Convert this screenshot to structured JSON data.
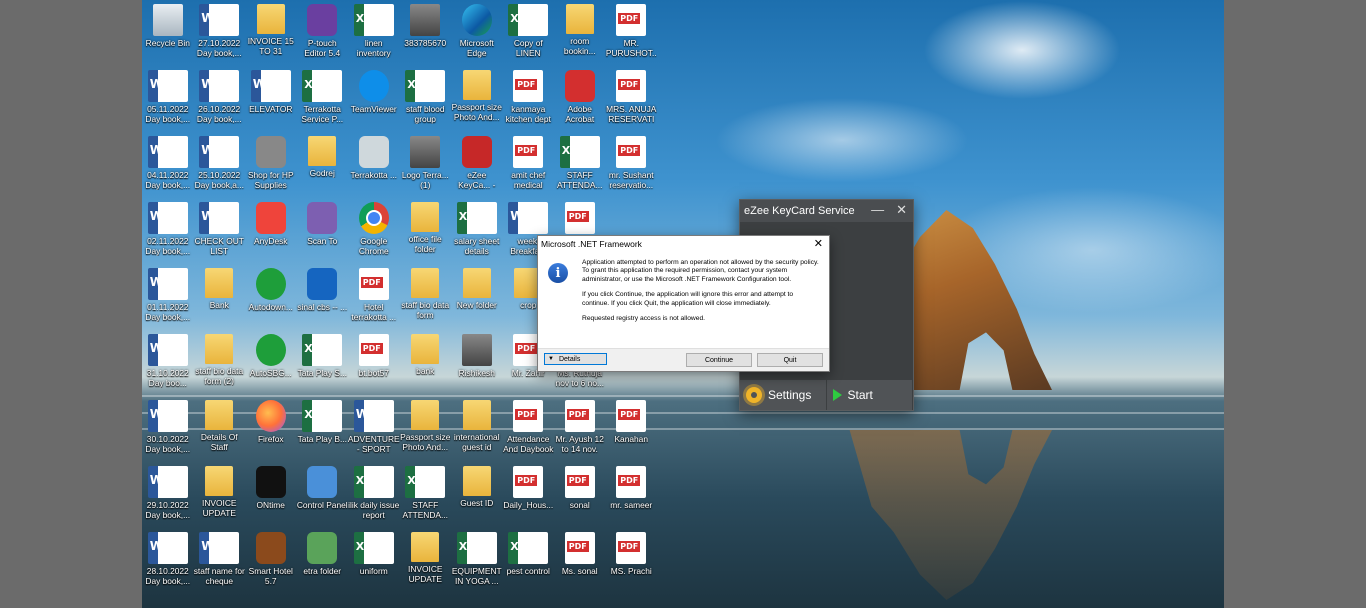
{
  "desktop": {
    "icons": [
      {
        "label": "Recycle Bin",
        "type": "recycle",
        "icon": "recycle-bin-icon"
      },
      {
        "label": "27.10.2022 Day book,...",
        "type": "word",
        "icon": "word-doc-icon"
      },
      {
        "label": "INVOICE 15 TO 31",
        "type": "folder",
        "icon": "folder-icon"
      },
      {
        "label": "P-touch Editor 5.4",
        "type": "app",
        "icon": "ptouch-icon",
        "color": "#6a3fa0"
      },
      {
        "label": "linen inventory",
        "type": "excel",
        "icon": "excel-doc-icon"
      },
      {
        "label": "383785670",
        "type": "photo",
        "icon": "image-file-icon"
      },
      {
        "label": "Microsoft Edge",
        "type": "edge",
        "icon": "edge-icon"
      },
      {
        "label": "Copy of LINEN INVE...",
        "type": "excel",
        "icon": "excel-doc-icon"
      },
      {
        "label": "room bookin...",
        "type": "folder",
        "icon": "folder-icon"
      },
      {
        "label": "MR. PURUSHOT...",
        "type": "pdf",
        "icon": "pdf-icon"
      },
      {
        "label": "05.11.2022 Day book,...",
        "type": "word",
        "icon": "word-doc-icon"
      },
      {
        "label": "26.10.2022 Day book,...",
        "type": "word",
        "icon": "word-doc-icon"
      },
      {
        "label": "ELEVATOR",
        "type": "word",
        "icon": "word-doc-icon"
      },
      {
        "label": "Terrakotta Service P...",
        "type": "excel",
        "icon": "excel-doc-icon"
      },
      {
        "label": "TeamViewer",
        "type": "tv",
        "icon": "teamviewer-icon"
      },
      {
        "label": "staff blood group",
        "type": "excel",
        "icon": "excel-doc-icon"
      },
      {
        "label": "Passport size Photo And...",
        "type": "folder",
        "icon": "folder-icon"
      },
      {
        "label": "kanmaya kitchen dept",
        "type": "pdf",
        "icon": "document-icon"
      },
      {
        "label": "Adobe Acrobat",
        "type": "app",
        "icon": "acrobat-icon",
        "color": "#d32f2f"
      },
      {
        "label": "MRS. ANUJA RESERVATIO...",
        "type": "pdf",
        "icon": "pdf-icon"
      },
      {
        "label": "04.11.2022 Day book,...",
        "type": "word",
        "icon": "word-doc-icon"
      },
      {
        "label": "25.10.2022 Day book,a...",
        "type": "word",
        "icon": "word-doc-icon"
      },
      {
        "label": "Shop for HP Supplies",
        "type": "app",
        "icon": "printer-icon",
        "color": "#888888"
      },
      {
        "label": "Godrej",
        "type": "folder",
        "icon": "folder-icon"
      },
      {
        "label": "Terrakotta ...",
        "type": "app",
        "icon": "phone-app-icon",
        "color": "#cfd8dc"
      },
      {
        "label": "Logo Terra... (1)",
        "type": "photo",
        "icon": "image-file-icon"
      },
      {
        "label": "eZee KeyCa... - Shortcut",
        "type": "app",
        "icon": "ezee-key-icon",
        "color": "#c62828"
      },
      {
        "label": "amit chef medical",
        "type": "pdf",
        "icon": "document-icon"
      },
      {
        "label": "STAFF ATTENDA...",
        "type": "excel",
        "icon": "excel-doc-icon"
      },
      {
        "label": "mr. Sushant reservatio...",
        "type": "pdf",
        "icon": "pdf-icon"
      },
      {
        "label": "02.11.2022 Day book,...",
        "type": "word",
        "icon": "word-doc-icon"
      },
      {
        "label": "CHECK OUT LIST",
        "type": "word",
        "icon": "word-doc-icon"
      },
      {
        "label": "AnyDesk",
        "type": "app",
        "icon": "anydesk-icon",
        "color": "#ef443b"
      },
      {
        "label": "Scan To",
        "type": "app",
        "icon": "scan-icon",
        "color": "#7d5fb1"
      },
      {
        "label": "Google Chrome",
        "type": "chrome",
        "icon": "chrome-icon"
      },
      {
        "label": "office file folder",
        "type": "folder",
        "icon": "folder-icon"
      },
      {
        "label": "salary sheet details",
        "type": "excel",
        "icon": "excel-doc-icon"
      },
      {
        "label": "weekl Breakfa...",
        "type": "word",
        "icon": "word-doc-icon"
      },
      {
        "label": "",
        "type": "pdf",
        "icon": "document-icon"
      },
      {
        "label": "",
        "type": "none",
        "icon": ""
      },
      {
        "label": "01.11.2022 Day book,...",
        "type": "word",
        "icon": "word-doc-icon"
      },
      {
        "label": "Bank",
        "type": "folder",
        "icon": "folder-icon"
      },
      {
        "label": "Autodown...",
        "type": "green-round",
        "icon": "autodown-icon"
      },
      {
        "label": "sinal cbs -- ...",
        "type": "app",
        "icon": "sinal-icon",
        "color": "#1565c0"
      },
      {
        "label": "Hotel terrakotta ...",
        "type": "pdf",
        "icon": "pdf-icon"
      },
      {
        "label": "staff bio data form",
        "type": "folder",
        "icon": "folder-icon"
      },
      {
        "label": "New folder",
        "type": "folder",
        "icon": "folder-icon"
      },
      {
        "label": "crop",
        "type": "folder",
        "icon": "folder-icon"
      },
      {
        "label": "",
        "type": "none",
        "icon": ""
      },
      {
        "label": "",
        "type": "none",
        "icon": ""
      },
      {
        "label": "31.10.2022 Day boo...",
        "type": "word",
        "icon": "word-doc-icon"
      },
      {
        "label": "staff bio data form (2)",
        "type": "folder",
        "icon": "folder-icon"
      },
      {
        "label": "AutoSBG...",
        "type": "green-round",
        "icon": "autosbg-icon"
      },
      {
        "label": "Tata Play S...",
        "type": "excel",
        "icon": "excel-doc-icon"
      },
      {
        "label": "bt.bot57",
        "type": "pdf",
        "icon": "document-icon"
      },
      {
        "label": "bank",
        "type": "folder",
        "icon": "folder-icon"
      },
      {
        "label": "Rishikesh",
        "type": "photo",
        "icon": "person-photo-icon"
      },
      {
        "label": "Mr. Zahir",
        "type": "pdf",
        "icon": "pdf-icon"
      },
      {
        "label": "Ms. Ruthuja nov to 6 no...",
        "type": "pdf",
        "icon": "pdf-icon"
      },
      {
        "label": "",
        "type": "none",
        "icon": ""
      },
      {
        "label": "30.10.2022 Day book,...",
        "type": "word",
        "icon": "word-doc-icon"
      },
      {
        "label": "Details Of Staff",
        "type": "folder",
        "icon": "folder-icon"
      },
      {
        "label": "Firefox",
        "type": "firefox",
        "icon": "firefox-icon"
      },
      {
        "label": "Tata Play B...",
        "type": "excel",
        "icon": "excel-doc-icon"
      },
      {
        "label": "ADVENTURE - SPORT",
        "type": "word",
        "icon": "word-doc-icon"
      },
      {
        "label": "Passport size Photo And...",
        "type": "folder",
        "icon": "folder-icon"
      },
      {
        "label": "international guest id",
        "type": "folder",
        "icon": "folder-icon"
      },
      {
        "label": "Attendance And Daybook",
        "type": "pdf",
        "icon": "pdf-icon"
      },
      {
        "label": "Mr. Ayush 12 to 14 nov.",
        "type": "pdf",
        "icon": "pdf-icon"
      },
      {
        "label": "Kanahan",
        "type": "pdf",
        "icon": "pdf-icon"
      },
      {
        "label": "29.10.2022 Day book,...",
        "type": "word",
        "icon": "word-doc-icon"
      },
      {
        "label": "INVOICE UPDATE",
        "type": "folder",
        "icon": "folder-icon"
      },
      {
        "label": "ONtime",
        "type": "app",
        "icon": "ontime-icon",
        "color": "#111111"
      },
      {
        "label": "Control Panel",
        "type": "app",
        "icon": "control-panel-icon",
        "color": "#4a90d9"
      },
      {
        "label": "ilik daily issue report",
        "type": "excel",
        "icon": "excel-doc-icon"
      },
      {
        "label": "STAFF ATTENDA...",
        "type": "excel",
        "icon": "excel-doc-icon"
      },
      {
        "label": "Guest ID",
        "type": "folder",
        "icon": "folder-icon"
      },
      {
        "label": "Daily_Hous...",
        "type": "pdf",
        "icon": "pdf-icon"
      },
      {
        "label": "sonal",
        "type": "pdf",
        "icon": "pdf-icon"
      },
      {
        "label": "mr. sameer",
        "type": "pdf",
        "icon": "pdf-icon"
      },
      {
        "label": "28.10.2022 Day book,...",
        "type": "word",
        "icon": "word-doc-icon"
      },
      {
        "label": "staff name for cheque",
        "type": "word",
        "icon": "word-doc-icon"
      },
      {
        "label": "Smart Hotel 5.7",
        "type": "app",
        "icon": "smart-hotel-icon",
        "color": "#8b4a1c"
      },
      {
        "label": "etra folder",
        "type": "app",
        "icon": "folder-sync-icon",
        "color": "#5aa35a"
      },
      {
        "label": "uniform",
        "type": "excel",
        "icon": "excel-doc-icon"
      },
      {
        "label": "INVOICE UPDATE",
        "type": "folder",
        "icon": "folder-icon"
      },
      {
        "label": "EQUIPMENT IN YOGA ...",
        "type": "excel",
        "icon": "excel-doc-icon"
      },
      {
        "label": "pest control",
        "type": "excel",
        "icon": "excel-doc-icon"
      },
      {
        "label": "Ms. sonal",
        "type": "pdf",
        "icon": "pdf-icon"
      },
      {
        "label": "MS. Prachi",
        "type": "pdf",
        "icon": "pdf-icon"
      }
    ]
  },
  "ezee_window": {
    "title": "eZee KeyCard Service",
    "minimize": "—",
    "close": "✕",
    "settings_label": "Settings",
    "start_label": "Start"
  },
  "net_dialog": {
    "title": "Microsoft .NET Framework",
    "close": "✕",
    "info_glyph": "i",
    "paragraph1": "Application attempted to perform an operation not allowed by the security policy. To grant this application the required permission, contact your system administrator, or use the Microsoft .NET Framework Configuration tool.",
    "paragraph2": "If you click Continue, the application will ignore this error and attempt to continue. If you click Quit, the application will close immediately.",
    "paragraph3": "Requested registry access is not allowed.",
    "details_label": "Details",
    "details_arrow": "▼",
    "continue_label": "Continue",
    "quit_label": "Quit"
  }
}
